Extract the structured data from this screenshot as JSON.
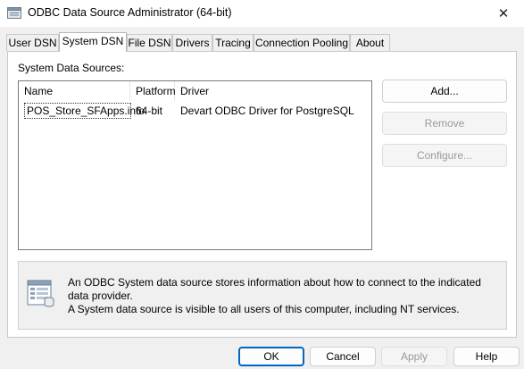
{
  "window": {
    "title": "ODBC Data Source Administrator (64-bit)",
    "close_glyph": "✕"
  },
  "tabs": [
    {
      "label": "User DSN"
    },
    {
      "label": "System DSN",
      "active": true
    },
    {
      "label": "File DSN"
    },
    {
      "label": "Drivers"
    },
    {
      "label": "Tracing"
    },
    {
      "label": "Connection Pooling"
    },
    {
      "label": "About"
    }
  ],
  "system_dsn": {
    "list_label": "System Data Sources:",
    "columns": [
      "Name",
      "Platform",
      "Driver"
    ],
    "rows": [
      {
        "name": "POS_Store_SFApps.info",
        "platform": "64-bit",
        "driver": "Devart ODBC Driver for PostgreSQL"
      }
    ],
    "buttons": {
      "add": "Add...",
      "remove": "Remove",
      "configure": "Configure..."
    },
    "info": {
      "icon": "data-source-icon",
      "text_line1": "An ODBC System data source stores information about how to connect to the indicated data provider.",
      "text_line2": "A System data source is visible to all users of this computer, including NT services."
    }
  },
  "footer": {
    "ok": "OK",
    "cancel": "Cancel",
    "apply": "Apply",
    "help": "Help"
  },
  "colors": {
    "accent": "#0067c0",
    "disabled_text": "#9a9a9a",
    "dialog_bg": "#f0f0f0"
  }
}
